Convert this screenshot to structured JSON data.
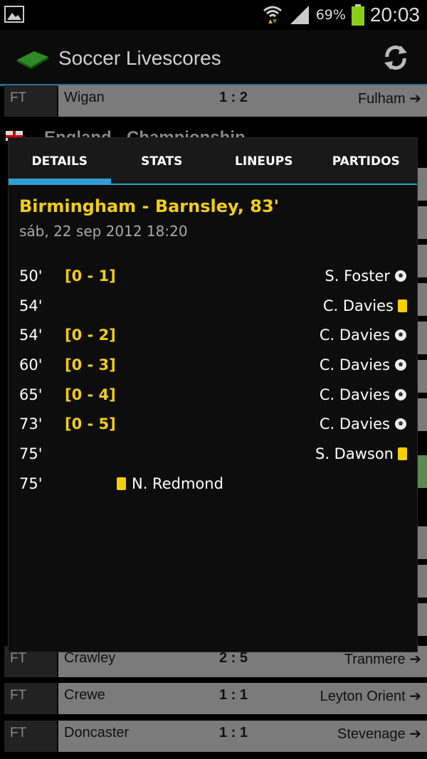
{
  "status_bar": {
    "battery_percent": "69%",
    "time": "20:03"
  },
  "app": {
    "title": "Soccer Livescores"
  },
  "background_list": {
    "top_row": {
      "status": "FT",
      "home": "Wigan",
      "score": "1 : 2",
      "away": "Fulham"
    },
    "league_partial": "England - Championship",
    "bottom_rows": [
      {
        "status": "FT",
        "home": "Crawley",
        "score": "2 : 5",
        "away": "Tranmere"
      },
      {
        "status": "FT",
        "home": "Crewe",
        "score": "1 : 1",
        "away": "Leyton Orient"
      },
      {
        "status": "FT",
        "home": "Doncaster",
        "score": "1 : 1",
        "away": "Stevenage"
      }
    ]
  },
  "dialog": {
    "tabs": [
      "DETAILS",
      "STATS",
      "LINEUPS",
      "PARTIDOS"
    ],
    "active_tab": "DETAILS",
    "match_title": "Birmingham - Barnsley, 83'",
    "match_date": "sáb, 22 sep 2012 18:20",
    "events": [
      {
        "minute": "50'",
        "score": "[0 - 1]",
        "player": "S. Foster",
        "side": "away",
        "type": "goal-icon"
      },
      {
        "minute": "54'",
        "score": "",
        "player": "C. Davies",
        "side": "away",
        "type": "yellow-card-icon"
      },
      {
        "minute": "54'",
        "score": "[0 - 2]",
        "player": "C. Davies",
        "side": "away",
        "type": "goal-icon"
      },
      {
        "minute": "60'",
        "score": "[0 - 3]",
        "player": "C. Davies",
        "side": "away",
        "type": "goal-icon"
      },
      {
        "minute": "65'",
        "score": "[0 - 4]",
        "player": "C. Davies",
        "side": "away",
        "type": "goal-icon"
      },
      {
        "minute": "73'",
        "score": "[0 - 5]",
        "player": "C. Davies",
        "side": "away",
        "type": "goal-icon"
      },
      {
        "minute": "75'",
        "score": "",
        "player": "S. Dawson",
        "side": "away",
        "type": "yellow-card-icon"
      },
      {
        "minute": "75'",
        "score": "",
        "player": "N. Redmond",
        "side": "home",
        "type": "yellow-card-icon"
      }
    ]
  },
  "colors": {
    "accent": "#2f9fd4",
    "highlight": "#f2cd14",
    "yellow_card": "#f3d100"
  }
}
